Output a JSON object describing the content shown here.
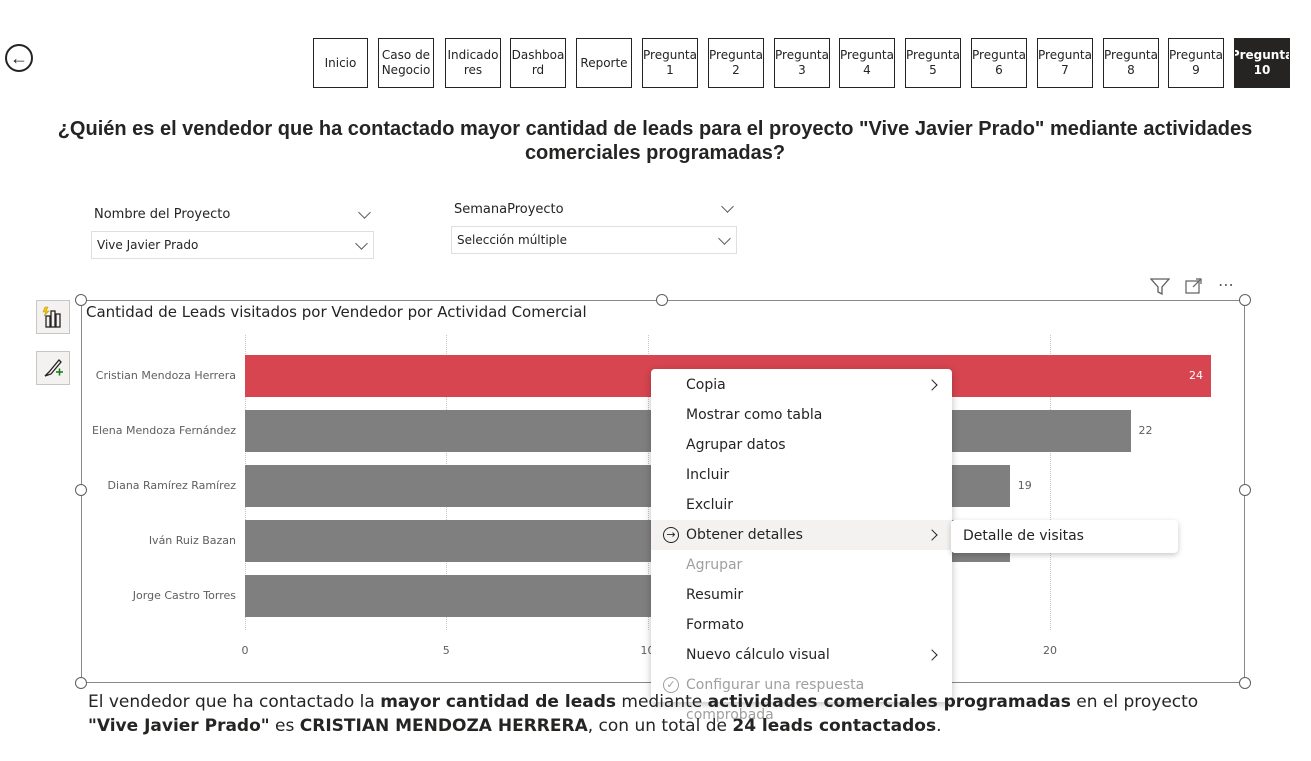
{
  "nav": {
    "back_icon": "arrow-left-circle-icon",
    "buttons": [
      {
        "label": "Inicio",
        "active": false
      },
      {
        "label": "Caso de\nNegocio",
        "active": false
      },
      {
        "label": "Indicado\nres",
        "active": false
      },
      {
        "label": "Dashboa\nrd",
        "active": false
      },
      {
        "label": "Reporte",
        "active": false
      },
      {
        "label": "Pregunta\n1",
        "active": false
      },
      {
        "label": "Pregunta\n2",
        "active": false
      },
      {
        "label": "Pregunta\n3",
        "active": false
      },
      {
        "label": "Pregunta\n4",
        "active": false
      },
      {
        "label": "Pregunta\n5",
        "active": false
      },
      {
        "label": "Pregunta\n6",
        "active": false
      },
      {
        "label": "Pregunta\n7",
        "active": false
      },
      {
        "label": "Pregunta\n8",
        "active": false
      },
      {
        "label": "Pregunta\n9",
        "active": false
      },
      {
        "label": "Pregunta\n10",
        "active": true
      }
    ]
  },
  "page_title": "¿Quién es el vendedor que ha contactado mayor cantidad de leads para el proyecto \"Vive Javier Prado\" mediante actividades comerciales programadas?",
  "slicers": {
    "project": {
      "label": "Nombre del Proyecto",
      "value": "Vive Javier Prado"
    },
    "week": {
      "label": "SemanaProyecto",
      "value": "Selección múltiple"
    }
  },
  "visual": {
    "title": "Cantidad de Leads visitados por Vendedor por Actividad Comercial",
    "header_icons": [
      "filter-icon",
      "focus-mode-icon",
      "more-options-icon"
    ],
    "side_icons": [
      "build-visual-icon",
      "format-visual-icon"
    ]
  },
  "chart_data": {
    "type": "bar",
    "orientation": "horizontal",
    "categories": [
      "Cristian Mendoza Herrera",
      "Elena Mendoza Fernández",
      "Diana Ramírez Ramírez",
      "Iván Ruiz Bazan",
      "Jorge Castro Torres"
    ],
    "values": [
      24,
      22,
      19,
      19,
      17
    ],
    "value_labels": [
      "24",
      "22",
      "19",
      "",
      ""
    ],
    "highlight_index": 0,
    "colors": {
      "highlight": "#d64550",
      "default": "#7f7f7f"
    },
    "xticks": [
      "0",
      "5",
      "10",
      "20"
    ],
    "xlim": [
      0,
      24
    ],
    "grid": true
  },
  "context_menu": {
    "items": [
      {
        "label": "Copia",
        "submenu": true,
        "disabled": false,
        "icon": ""
      },
      {
        "label": "Mostrar como tabla",
        "submenu": false,
        "disabled": false,
        "icon": ""
      },
      {
        "label": "Agrupar datos",
        "submenu": false,
        "disabled": false,
        "icon": ""
      },
      {
        "label": "Incluir",
        "submenu": false,
        "disabled": false,
        "icon": ""
      },
      {
        "label": "Excluir",
        "submenu": false,
        "disabled": false,
        "icon": ""
      },
      {
        "label": "Obtener detalles",
        "submenu": true,
        "disabled": false,
        "icon": "drillthrough-icon",
        "highlighted": true
      },
      {
        "label": "Agrupar",
        "submenu": false,
        "disabled": true,
        "icon": ""
      },
      {
        "label": "Resumir",
        "submenu": false,
        "disabled": false,
        "icon": ""
      },
      {
        "label": "Formato",
        "submenu": false,
        "disabled": false,
        "icon": ""
      },
      {
        "label": "Nuevo cálculo visual",
        "submenu": true,
        "disabled": false,
        "icon": ""
      },
      {
        "label": "Configurar una respuesta comprobada",
        "submenu": false,
        "disabled": true,
        "icon": "verified-answer-icon"
      }
    ],
    "submenu_item": "Detalle de visitas"
  },
  "caption": {
    "p1": "El vendedor que ha contactado la ",
    "b1": "mayor cantidad de leads",
    "p2": " mediante ",
    "b2": "actividades comerciales programadas",
    "p3": " en el proyecto ",
    "b3": "\"Vive Javier Prado\"",
    "p4": " es ",
    "b4": "CRISTIAN MENDOZA HERRERA",
    "p5": ", con un total de ",
    "b5": "24 leads contactados",
    "p6": "."
  }
}
